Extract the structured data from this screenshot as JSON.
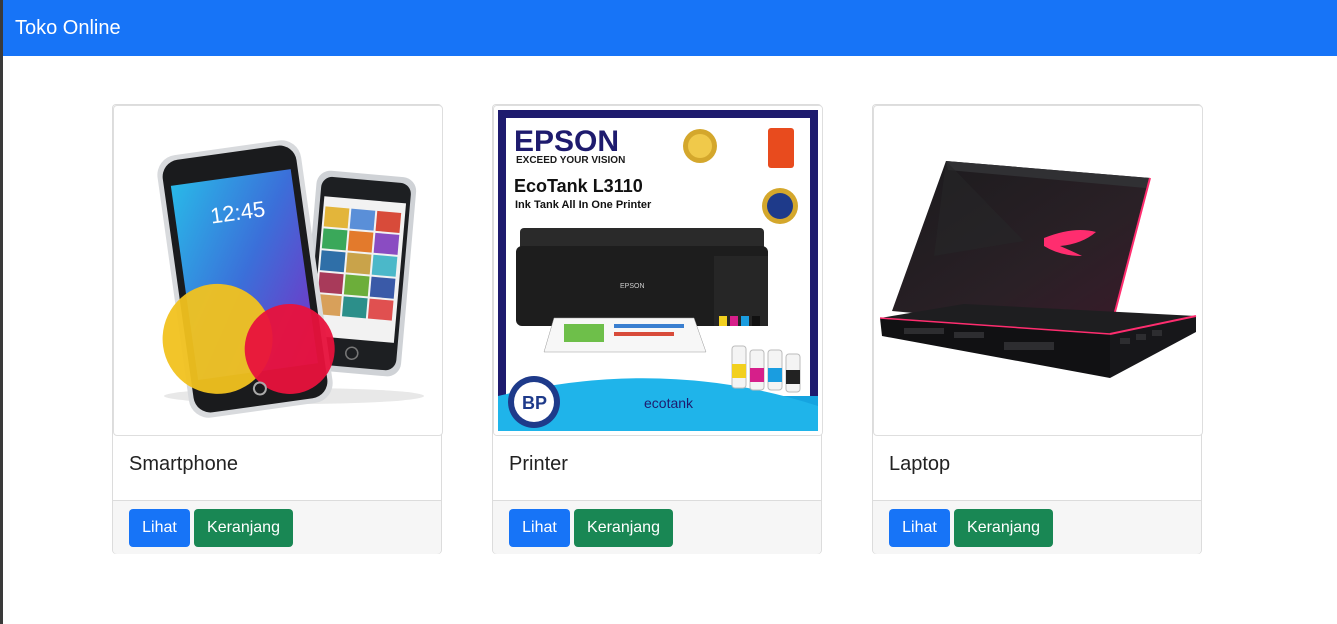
{
  "app": {
    "title": "Toko Online"
  },
  "products": [
    {
      "name": "Smartphone",
      "view_label": "Lihat",
      "cart_label": "Keranjang"
    },
    {
      "name": "Printer",
      "view_label": "Lihat",
      "cart_label": "Keranjang"
    },
    {
      "name": "Laptop",
      "view_label": "Lihat",
      "cart_label": "Keranjang"
    }
  ],
  "printer_image": {
    "brand": "EPSON",
    "tagline": "EXCEED YOUR VISION",
    "model": "EcoTank L3110",
    "subtitle": "Ink Tank All In One Printer",
    "eco_logo": "ecotank"
  },
  "colors": {
    "navbar": "#1774f7",
    "primary_button": "#1774f7",
    "success_button": "#198754"
  }
}
